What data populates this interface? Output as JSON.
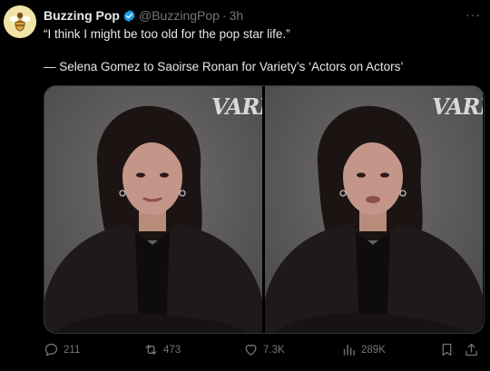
{
  "tweet": {
    "author_name": "Buzzing Pop",
    "handle": "@BuzzingPop",
    "separator": "·",
    "time": "3h",
    "more": "···",
    "text_line1": "“I think I might be too old for the pop star life.”",
    "text_line2": "— Selena Gomez to Saoirse Ronan for Variety’s ‘Actors on Actors’"
  },
  "media": {
    "watermark_left": "VARIE",
    "watermark_right": "VARIE"
  },
  "actions": {
    "replies": "211",
    "reposts": "473",
    "likes": "7.3K",
    "views": "289K"
  },
  "colors": {
    "background": "#000000",
    "text": "#e7e9ea",
    "muted": "#71767b",
    "verified": "#1d9bf0"
  }
}
